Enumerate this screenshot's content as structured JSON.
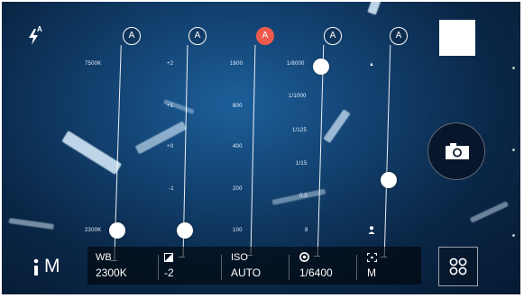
{
  "flash": {
    "icon": "flash-auto-icon",
    "superscript": "A"
  },
  "auto_badge": "A",
  "wb": {
    "label": "WB",
    "value": "2300K",
    "ticks": [
      "7500K",
      "2300K"
    ]
  },
  "ev": {
    "value": "-2",
    "ticks": [
      "+2",
      "+1",
      "+0",
      "-1"
    ]
  },
  "iso": {
    "label": "ISO",
    "value": "AUTO",
    "ticks": [
      "1600",
      "800",
      "400",
      "200",
      "100"
    ]
  },
  "shutter": {
    "value": "1/6400",
    "ticks": [
      "1/8000",
      "1/1000",
      "1/125",
      "1/15",
      "0.5",
      "8"
    ]
  },
  "focus": {
    "value": "M",
    "ticks": [
      "▲"
    ]
  },
  "mode": {
    "label": "M"
  },
  "colors": {
    "accent": "#ef5a4e",
    "hud": "#ffffff",
    "bar": "rgba(0,0,0,0.55)"
  }
}
